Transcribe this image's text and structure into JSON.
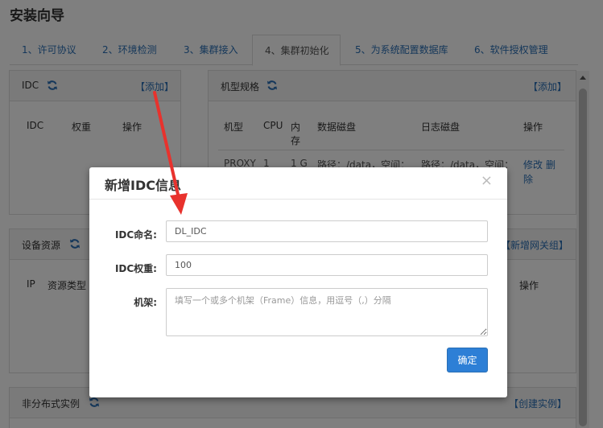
{
  "page_title": "安装向导",
  "tabs": [
    {
      "label": "1、许可协议"
    },
    {
      "label": "2、环境检测"
    },
    {
      "label": "3、集群接入"
    },
    {
      "label": "4、集群初始化",
      "active": true
    },
    {
      "label": "5、为系统配置数据库"
    },
    {
      "label": "6、软件授权管理"
    }
  ],
  "idc_panel": {
    "title": "IDC",
    "add_link": "【添加】",
    "columns": [
      "IDC",
      "权重",
      "操作"
    ]
  },
  "model_panel": {
    "title": "机型规格",
    "add_link": "【添加】",
    "columns": [
      "机型",
      "CPU",
      "内",
      "存",
      "数据磁盘",
      "日志磁盘",
      "操作"
    ],
    "row": {
      "model": "PROXY",
      "cpu": "1",
      "mem": "1 G",
      "data_disk": "路径：/data，空间：",
      "log_disk": "路径：/data，空间：",
      "edit": "修改",
      "delete": "删",
      "delete2": "除"
    }
  },
  "device_panel": {
    "title": "设备资源",
    "link": "【新增网关组】",
    "columns": [
      "IP",
      "资源类型",
      "操作"
    ]
  },
  "instance_panel": {
    "title": "非分布式实例",
    "link": "【创建实例】"
  },
  "modal": {
    "title": "新增IDC信息",
    "close": "×",
    "name_label": "IDC命名:",
    "name_value": "DL_IDC",
    "weight_label": "IDC权重:",
    "weight_value": "100",
    "rack_label": "机架:",
    "rack_placeholder": "填写一个或多个机架（Frame）信息，用逗号（,）分隔",
    "confirm": "确定"
  },
  "colors": {
    "link": "#2a6fb5",
    "primary_button": "#2d7fd6",
    "arrow": "#e8322d"
  }
}
